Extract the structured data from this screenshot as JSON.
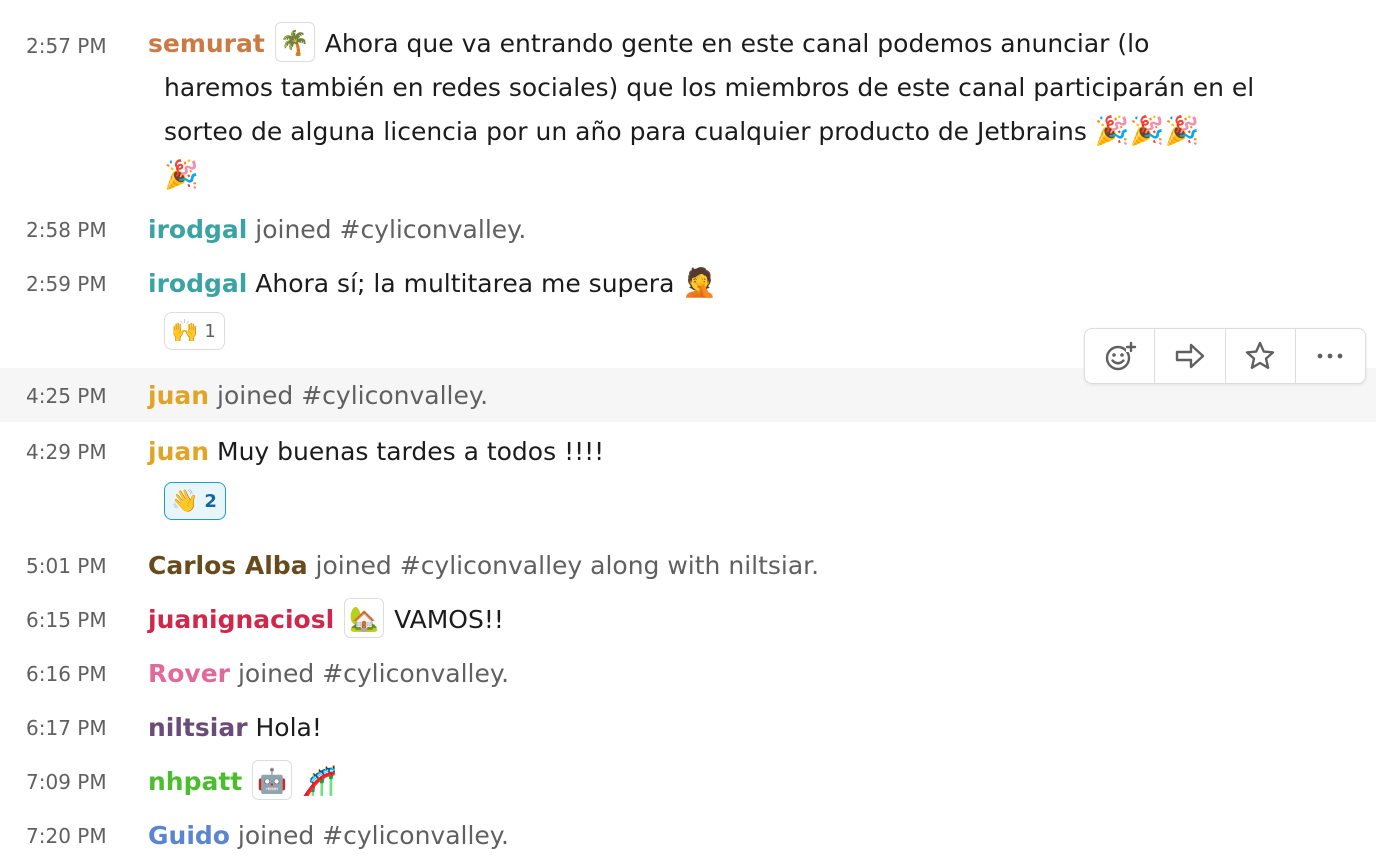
{
  "messages": [
    {
      "time": "2:57 PM",
      "user": "semurat",
      "user_color": "#cc7a44",
      "status_emoji": "🌴",
      "lines": [
        "Ahora que va entrando gente en este canal podemos anunciar (lo",
        "haremos también en redes sociales) que los miembros de este canal participarán en el",
        "sorteo de alguna licencia por un año para cualquier producto de Jetbrains"
      ],
      "trailing_emoji": "🎉🎉🎉",
      "overflow_emoji": "🎉"
    },
    {
      "time": "2:58 PM",
      "user": "irodgal",
      "user_color": "#3aa3a3",
      "text": "joined #cyliconvalley."
    },
    {
      "time": "2:59 PM",
      "user": "irodgal",
      "user_color": "#3aa3a3",
      "text": "Ahora sí; la multitarea me supera",
      "emoji": "🤦",
      "reaction": {
        "emoji": "🙌",
        "count": "1"
      }
    },
    {
      "time": "4:25 PM",
      "user": "juan",
      "user_color": "#e0a526",
      "text": "joined #cyliconvalley."
    },
    {
      "time": "4:29 PM",
      "user": "juan",
      "user_color": "#e0a526",
      "text": "Muy buenas tardes a todos !!!!",
      "reaction": {
        "emoji": "👋",
        "count": "2"
      }
    },
    {
      "time": "5:01 PM",
      "user": "Carlos Alba",
      "user_color": "#684b1c",
      "text": "joined #cyliconvalley along with niltsiar."
    },
    {
      "time": "6:15 PM",
      "user": "juanignaciosl",
      "user_color": "#d0284a",
      "status_emoji": "🏡",
      "text": "VAMOS!!"
    },
    {
      "time": "6:16 PM",
      "user": "Rover",
      "user_color": "#e06b9a",
      "text": "joined #cyliconvalley."
    },
    {
      "time": "6:17 PM",
      "user": "niltsiar",
      "user_color": "#6b4c78",
      "text": "Hola!"
    },
    {
      "time": "7:09 PM",
      "user": "nhpatt",
      "user_color": "#4bbe2e",
      "status_emoji": "🤖",
      "text": "🎢"
    },
    {
      "time": "7:20 PM",
      "user": "Guido",
      "user_color": "#5b86cf",
      "text": "joined #cyliconvalley."
    }
  ],
  "toolbar": {
    "items": [
      {
        "icon": "add-reaction-icon"
      },
      {
        "icon": "share-arrow-icon"
      },
      {
        "icon": "star-icon"
      },
      {
        "icon": "more-actions-icon"
      }
    ]
  }
}
